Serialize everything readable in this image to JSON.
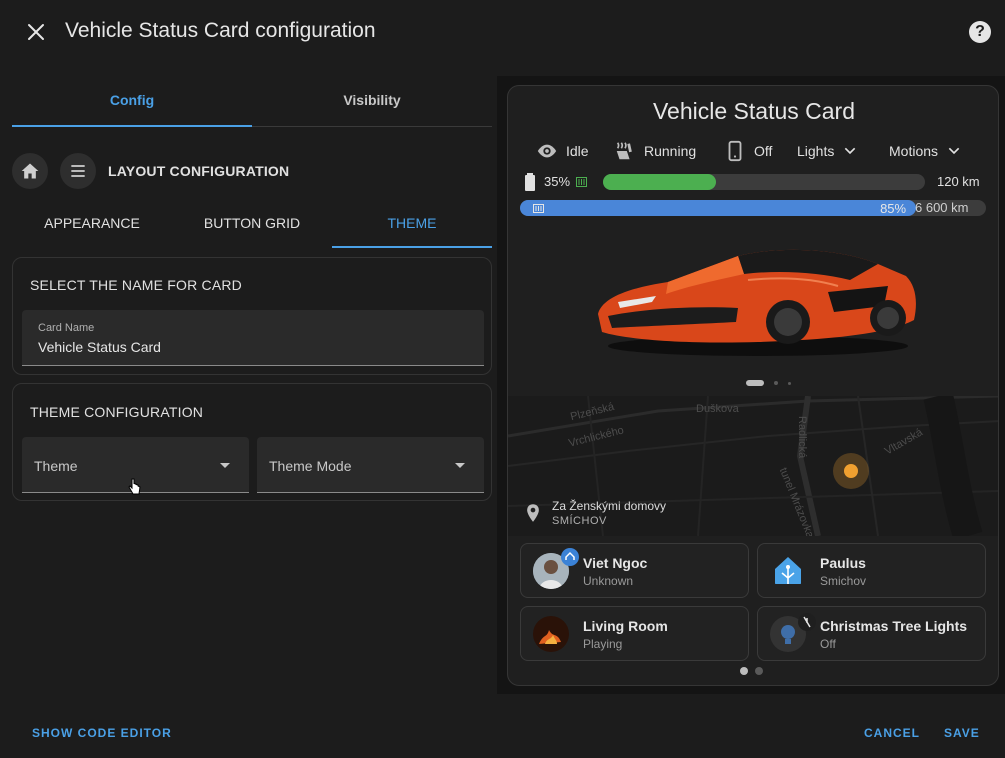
{
  "dialog": {
    "title": "Vehicle Status Card configuration",
    "close_icon": "close-icon",
    "help_icon": "help-circle-icon",
    "help_glyph": "?"
  },
  "tabs": [
    {
      "label": "Config",
      "active": true
    },
    {
      "label": "Visibility",
      "active": false
    }
  ],
  "layout": {
    "title": "LAYOUT CONFIGURATION",
    "home_icon": "home-icon",
    "menu_icon": "menu-icon"
  },
  "subtabs": [
    {
      "label": "APPEARANCE",
      "active": false
    },
    {
      "label": "BUTTON GRID",
      "active": false
    },
    {
      "label": "THEME",
      "active": true
    }
  ],
  "name_section": {
    "title": "SELECT THE NAME FOR CARD",
    "field_label": "Card Name",
    "field_value": "Vehicle Status Card"
  },
  "theme_section": {
    "title": "THEME CONFIGURATION",
    "theme_label": "Theme",
    "mode_label": "Theme Mode"
  },
  "footer": {
    "code_editor": "SHOW CODE EDITOR",
    "cancel": "CANCEL",
    "save": "SAVE"
  },
  "card": {
    "title": "Vehicle Status Card",
    "status": [
      {
        "icon": "eye-icon",
        "label": "Idle"
      },
      {
        "icon": "seat-heater-icon",
        "label": "Running"
      },
      {
        "icon": "phone-icon",
        "label": "Off"
      }
    ],
    "dropdowns": [
      {
        "label": "Lights",
        "icon": "chevron-down-icon"
      },
      {
        "label": "Motions",
        "icon": "chevron-down-icon"
      }
    ],
    "battery": {
      "percent": "35%",
      "fraction": 0.35,
      "range": "120 km",
      "fill_color": "#4caf50"
    },
    "fuel": {
      "percent": "85%",
      "fraction": 0.85,
      "range": "6 600 km",
      "fill_color": "#4a86d8"
    },
    "image_pages": 3,
    "map": {
      "labels": [
        "Plzeňská",
        "Duškova",
        "Vrchlického",
        "Radlická",
        "Vltavská",
        "tunel Mrázovka"
      ],
      "location_name": "Za Ženskými domovy",
      "location_area": "SMÍCHOV",
      "pin_icon": "map-pin-icon"
    },
    "tiles": [
      {
        "title": "Viet Ngoc",
        "subtitle": "Unknown",
        "icon": "person-avatar"
      },
      {
        "title": "Paulus",
        "subtitle": "Smichov",
        "icon": "home-assistant-icon"
      },
      {
        "title": "Living Room",
        "subtitle": "Playing",
        "icon": "fireplace-thumbnail"
      },
      {
        "title": "Christmas Tree Lights",
        "subtitle": "Off",
        "icon": "lightbulb-icon"
      }
    ],
    "tile_pages": 2
  },
  "colors": {
    "accent": "#4aa0e6",
    "background": "#1c1c1c",
    "card": "#1f1f1f",
    "car": "#e0511e",
    "marker": "#f0a030"
  }
}
